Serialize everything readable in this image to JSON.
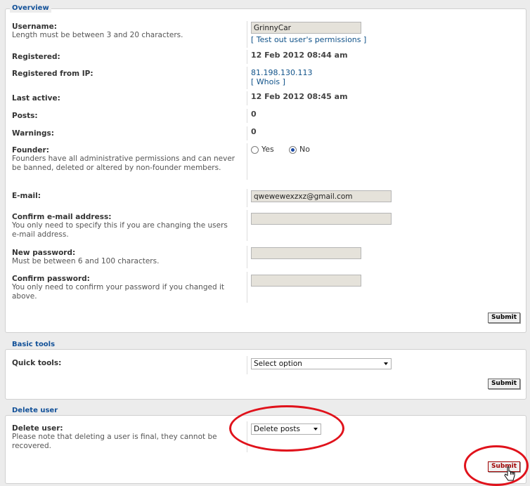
{
  "overview": {
    "legend": "Overview",
    "username": {
      "label": "Username:",
      "explain": "Length must be between 3 and 20 characters.",
      "value": "GrinnyCar",
      "link": "[ Test out user's permissions ]"
    },
    "registered": {
      "label": "Registered:",
      "value": "12 Feb 2012 08:44 am"
    },
    "registered_ip": {
      "label": "Registered from IP:",
      "value": "81.198.130.113",
      "link": "[ Whois ]"
    },
    "last_active": {
      "label": "Last active:",
      "value": "12 Feb 2012 08:45 am"
    },
    "posts": {
      "label": "Posts:",
      "value": "0"
    },
    "warnings": {
      "label": "Warnings:",
      "value": "0"
    },
    "founder": {
      "label": "Founder:",
      "explain": "Founders have all administrative permissions and can never be banned, deleted or altered by non-founder members.",
      "yes": "Yes",
      "no": "No",
      "selected": "No"
    },
    "email": {
      "label": "E-mail:",
      "value": "qwewewexzxz@gmail.com"
    },
    "confirm_email": {
      "label": "Confirm e-mail address:",
      "explain": "You only need to specify this if you are changing the users e-mail address.",
      "value": ""
    },
    "new_password": {
      "label": "New password:",
      "explain": "Must be between 6 and 100 characters.",
      "value": ""
    },
    "confirm_password": {
      "label": "Confirm password:",
      "explain": "You only need to confirm your password if you changed it above.",
      "value": ""
    },
    "submit": "Submit"
  },
  "basic_tools": {
    "legend": "Basic tools",
    "quick_tools": {
      "label": "Quick tools:",
      "selected": "Select option"
    },
    "submit": "Submit"
  },
  "delete_user": {
    "legend": "Delete user",
    "label": "Delete user:",
    "explain": "Please note that deleting a user is final, they cannot be recovered.",
    "selected": "Delete posts",
    "submit": "Submit"
  },
  "colors": {
    "accent": "#115098",
    "annotation": "#e0121b",
    "input_bg": "#e5e2da"
  }
}
